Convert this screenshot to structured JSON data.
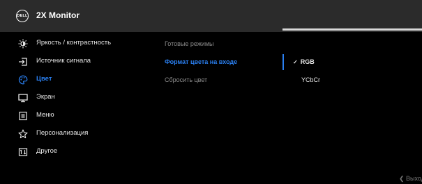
{
  "header": {
    "logo_text": "DELL",
    "title": "2X Monitor"
  },
  "menu": {
    "items": [
      {
        "label": "Яркость / контрастность",
        "icon": "brightness-icon"
      },
      {
        "label": "Источник сигнала",
        "icon": "input-source-icon"
      },
      {
        "label": "Цвет",
        "icon": "color-palette-icon",
        "active": true
      },
      {
        "label": "Экран",
        "icon": "display-icon"
      },
      {
        "label": "Меню",
        "icon": "menu-icon"
      },
      {
        "label": "Персонализация",
        "icon": "star-icon"
      },
      {
        "label": "Другое",
        "icon": "other-icon"
      }
    ]
  },
  "submenu": {
    "items": [
      {
        "label": "Готовые режимы"
      },
      {
        "label": "Формат цвета на входе",
        "active": true
      },
      {
        "label": "Сбросить цвет"
      }
    ]
  },
  "options": {
    "check_mark": "✓",
    "items": [
      {
        "label": "RGB",
        "selected": true
      },
      {
        "label": "YCbCr"
      }
    ]
  },
  "footer": {
    "exit_label": "❮ Выход"
  },
  "colors": {
    "accent": "#2a7ff0",
    "background": "#000000",
    "header": "#2b2b2b"
  }
}
